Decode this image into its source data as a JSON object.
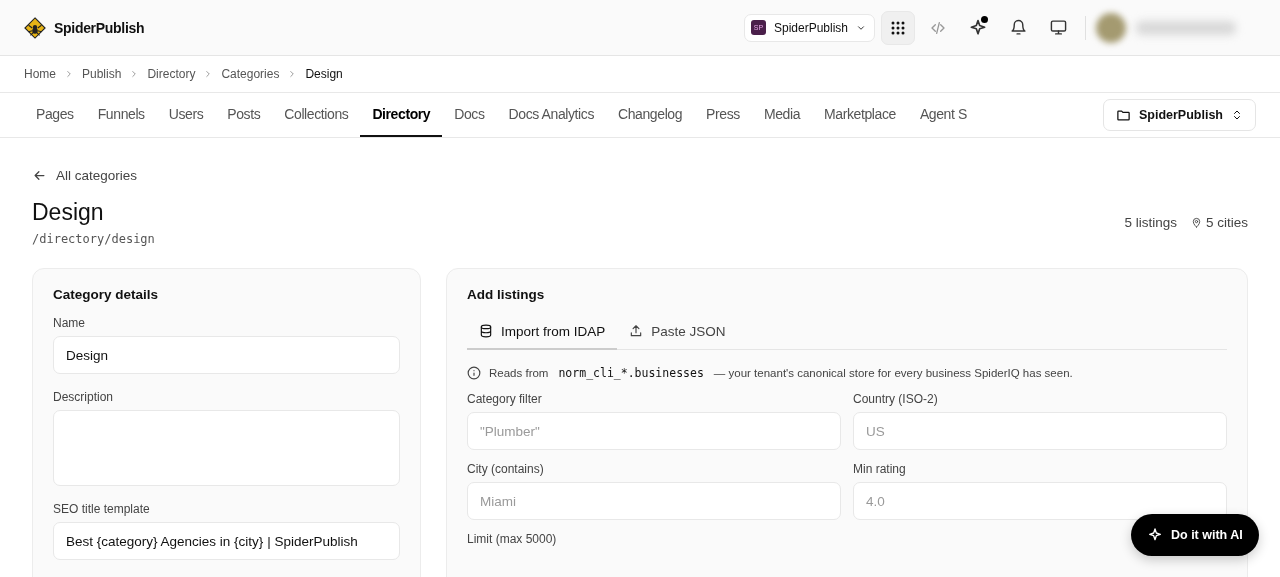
{
  "header": {
    "brand": "SpiderPublish",
    "workspace": {
      "badge": "SP",
      "name": "SpiderPublish"
    },
    "notification_dot": true
  },
  "breadcrumbs": [
    {
      "label": "Home",
      "current": false
    },
    {
      "label": "Publish",
      "current": false
    },
    {
      "label": "Directory",
      "current": false
    },
    {
      "label": "Categories",
      "current": false
    },
    {
      "label": "Design",
      "current": true
    }
  ],
  "nav_tabs": [
    {
      "label": "Pages",
      "selected": false
    },
    {
      "label": "Funnels",
      "selected": false
    },
    {
      "label": "Users",
      "selected": false
    },
    {
      "label": "Posts",
      "selected": false
    },
    {
      "label": "Collections",
      "selected": false
    },
    {
      "label": "Directory",
      "selected": true
    },
    {
      "label": "Docs",
      "selected": false
    },
    {
      "label": "Docs Analytics",
      "selected": false
    },
    {
      "label": "Changelog",
      "selected": false
    },
    {
      "label": "Press",
      "selected": false
    },
    {
      "label": "Media",
      "selected": false
    },
    {
      "label": "Marketplace",
      "selected": false
    },
    {
      "label": "Agent S",
      "selected": false
    }
  ],
  "site_selector": "SpiderPublish",
  "back_link": "All categories",
  "page": {
    "title": "Design",
    "path": "/directory/design",
    "listings": "5 listings",
    "cities": "5 cities"
  },
  "category_details": {
    "title": "Category details",
    "fields": [
      {
        "label": "Name",
        "kind": "input",
        "value": "Design"
      },
      {
        "label": "Description",
        "kind": "textarea"
      },
      {
        "label": "SEO title template",
        "kind": "input",
        "value": "Best {category} Agencies in {city} | SpiderPublish"
      }
    ]
  },
  "add_listings": {
    "title": "Add listings",
    "tabs": [
      {
        "label": "Import from IDAP",
        "kind": "database",
        "selected": true
      },
      {
        "label": "Paste JSON",
        "kind": "upload",
        "selected": false
      }
    ],
    "info": {
      "before": "Reads from",
      "code": "norm_cli_*.businesses",
      "after": "— your tenant's canonical store for every business SpiderIQ has seen."
    },
    "fields": [
      {
        "label": "Category filter",
        "placeholder": "\"Plumber\""
      },
      {
        "label": "Country (ISO-2)",
        "placeholder": "US"
      },
      {
        "label": "City (contains)",
        "placeholder": "Miami"
      },
      {
        "label": "Min rating",
        "placeholder": "4.0"
      },
      {
        "label": "Limit (max 5000)"
      }
    ]
  },
  "ai_button": "Do it with AI"
}
